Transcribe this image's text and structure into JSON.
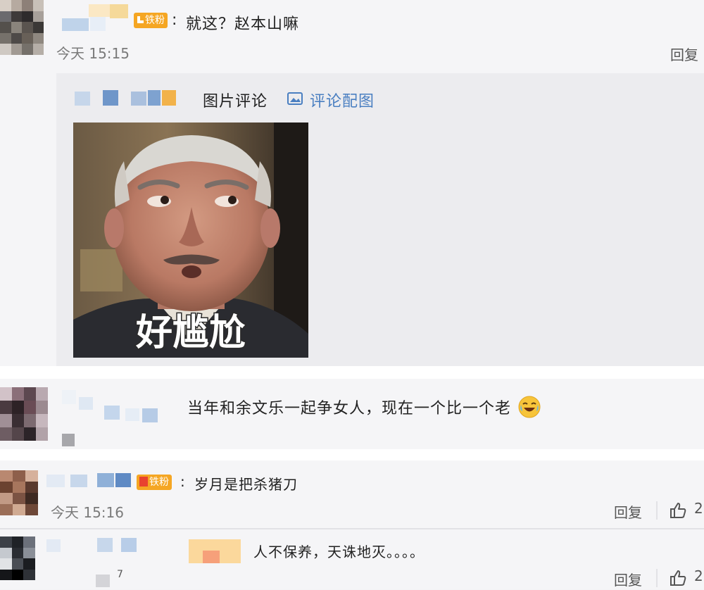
{
  "comment1": {
    "badge": "铁粉",
    "text": "就这？赵本山嘛",
    "time": "今天 15:15",
    "reply": "回复",
    "attachment": {
      "label": "图片评论",
      "link": "评论配图",
      "meme_caption": "好尴尬"
    }
  },
  "comment2": {
    "text": "当年和余文乐一起争女人，现在一个比一个老"
  },
  "comment3": {
    "badge": "铁粉",
    "text": "岁月是把杀猪刀",
    "time": "今天 15:16",
    "reply": "回复",
    "likes": "2"
  },
  "comment4": {
    "text": "人不保养，天诛地灭。。。。",
    "reply": "回复",
    "likes": "2",
    "count_fragment": "7"
  },
  "colors": {
    "badge": "#f5a623",
    "link": "#4a7fc1",
    "panel": "#f5f5f7"
  }
}
